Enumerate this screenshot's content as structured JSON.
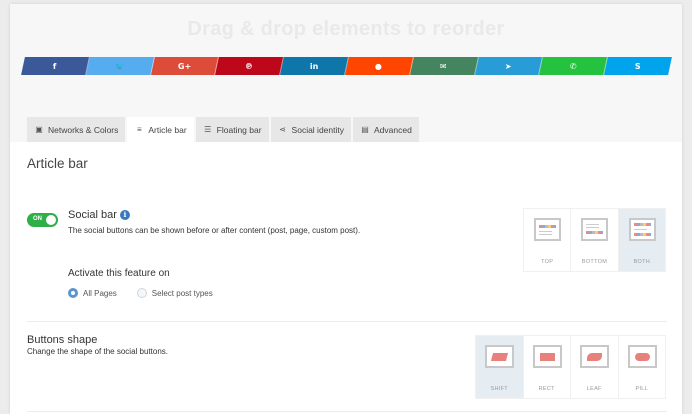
{
  "header": {
    "title": "Drag & drop elements to reorder"
  },
  "social_networks": [
    {
      "name": "facebook",
      "glyph": "f",
      "color": "#3b5998"
    },
    {
      "name": "twitter",
      "glyph": "🐦",
      "color": "#55acee"
    },
    {
      "name": "google-plus",
      "glyph": "G+",
      "color": "#dd4b39"
    },
    {
      "name": "pinterest",
      "glyph": "℗",
      "color": "#bd081c"
    },
    {
      "name": "linkedin",
      "glyph": "in",
      "color": "#0e76a8"
    },
    {
      "name": "reddit",
      "glyph": "●",
      "color": "#ff4500"
    },
    {
      "name": "email",
      "glyph": "✉",
      "color": "#44845f"
    },
    {
      "name": "telegram",
      "glyph": "➤",
      "color": "#279cd6"
    },
    {
      "name": "whatsapp",
      "glyph": "✆",
      "color": "#25c240"
    },
    {
      "name": "skype",
      "glyph": "S",
      "color": "#00a4ed"
    }
  ],
  "tabs": [
    {
      "label": "Networks & Colors",
      "icon": "image-icon",
      "glyph": "▣"
    },
    {
      "label": "Article bar",
      "icon": "list-icon",
      "glyph": "≡",
      "active": true
    },
    {
      "label": "Floating bar",
      "icon": "floating-bar-icon",
      "glyph": "☰"
    },
    {
      "label": "Social identity",
      "icon": "share-icon",
      "glyph": "⋖"
    },
    {
      "label": "Advanced",
      "icon": "settings-icon",
      "glyph": "▤"
    }
  ],
  "section_title": "Article bar",
  "social_bar": {
    "toggle_label": "ON",
    "enabled": true,
    "title": "Social bar",
    "info_glyph": "i",
    "description": "The social buttons can be shown before or after content (post, page, custom post).",
    "positions": [
      {
        "label": "TOP",
        "selected": false
      },
      {
        "label": "BOTTOM",
        "selected": false
      },
      {
        "label": "BOTH",
        "selected": true
      }
    ]
  },
  "activate": {
    "title": "Activate this feature on",
    "options": [
      {
        "label": "All Pages",
        "checked": true
      },
      {
        "label": "Select post types",
        "checked": false
      }
    ]
  },
  "buttons_shape": {
    "title": "Buttons shape",
    "description": "Change the shape of the social buttons.",
    "options": [
      {
        "label": "SHIFT",
        "shape": "shift",
        "selected": true
      },
      {
        "label": "RECT",
        "shape": "rect",
        "selected": false
      },
      {
        "label": "LEAF",
        "shape": "leaf",
        "selected": false
      },
      {
        "label": "PILL",
        "shape": "pill",
        "selected": false
      }
    ]
  }
}
